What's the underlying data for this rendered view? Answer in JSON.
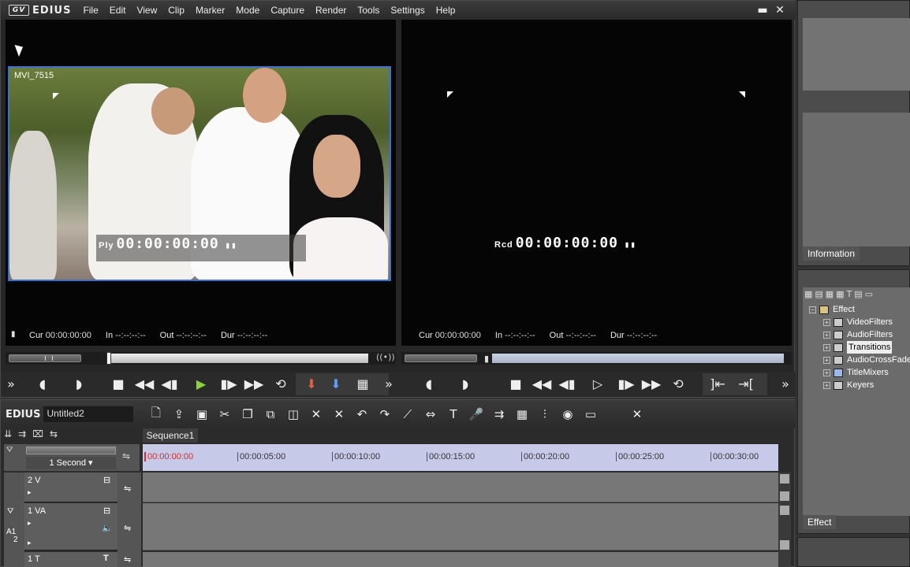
{
  "app": {
    "name": "EDIUS",
    "logo_mark": "GV"
  },
  "menu": [
    "File",
    "Edit",
    "View",
    "Clip",
    "Marker",
    "Mode",
    "Capture",
    "Render",
    "Tools",
    "Settings",
    "Help"
  ],
  "window_buttons": {
    "minimize": "▬",
    "close": "✕"
  },
  "player": {
    "clip_name": "MVI_7515",
    "timecode_label": "Ply",
    "timecode": "00:00:00:00",
    "cur_label": "Cur",
    "cur": "00:00:00:00",
    "in_label": "In",
    "in": "--:--:--:--",
    "out_label": "Out",
    "out": "--:--:--:--",
    "dur_label": "Dur",
    "dur": "--:--:--:--"
  },
  "recorder": {
    "timecode_label": "Rcd",
    "timecode": "00:00:00:00",
    "cur_label": "Cur",
    "cur": "00:00:00:00",
    "in_label": "In",
    "in": "--:--:--:--",
    "out_label": "Out",
    "out": "--:--:--:--",
    "dur_label": "Dur",
    "dur": "--:--:--:--"
  },
  "info_panel": {
    "tab": "Information"
  },
  "effect_panel": {
    "tab": "Effect",
    "tree": [
      {
        "label": "Effect",
        "level": 0,
        "selected": false
      },
      {
        "label": "VideoFilters",
        "level": 1,
        "selected": false
      },
      {
        "label": "AudioFilters",
        "level": 1,
        "selected": false
      },
      {
        "label": "Transitions",
        "level": 1,
        "selected": true
      },
      {
        "label": "AudioCrossFade",
        "level": 1,
        "selected": false
      },
      {
        "label": "TitleMixers",
        "level": 1,
        "selected": false
      },
      {
        "label": "Keyers",
        "level": 1,
        "selected": false
      }
    ]
  },
  "timeline": {
    "project_label": "EDIUS",
    "project_name": "Untitled2",
    "sequence_tab": "Sequence1",
    "scale": "1 Second",
    "ruler": [
      "00:00:00:00",
      "00:00:05:00",
      "00:00:10:00",
      "00:00:15:00",
      "00:00:20:00",
      "00:00:25:00",
      "00:00:30:00"
    ],
    "tracks": [
      {
        "name": "2 V"
      },
      {
        "name": "1 VA"
      },
      {
        "name": "1 T"
      }
    ],
    "a_label": "A",
    "a_num1": "1",
    "a_num2": "2"
  },
  "colors": {
    "play_green": "#8bd33a",
    "selection_blue": "#3d6fd0",
    "ruler_bg": "#c7c9e8",
    "ruler_start_red": "#d03030"
  }
}
